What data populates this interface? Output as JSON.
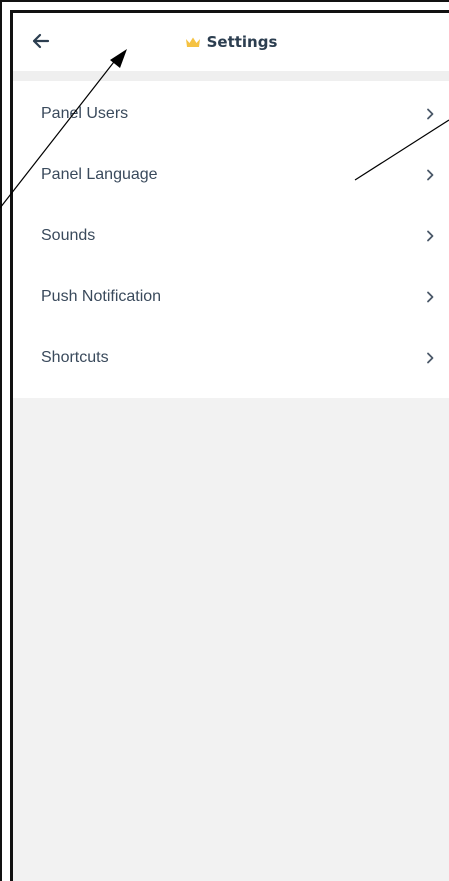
{
  "header": {
    "title": "Settings",
    "accent_color": "#f5c242",
    "back_icon": "arrow-left-icon",
    "title_icon": "crown-icon"
  },
  "menu": {
    "items": [
      {
        "label": "Panel Users",
        "icon": "chevron-right-icon"
      },
      {
        "label": "Panel Language",
        "icon": "chevron-right-icon"
      },
      {
        "label": "Sounds",
        "icon": "chevron-right-icon"
      },
      {
        "label": "Push Notification",
        "icon": "chevron-right-icon"
      },
      {
        "label": "Shortcuts",
        "icon": "chevron-right-icon"
      }
    ]
  },
  "colors": {
    "background": "#f2f2f2",
    "surface": "#ffffff",
    "text": "#3a4a5c"
  }
}
